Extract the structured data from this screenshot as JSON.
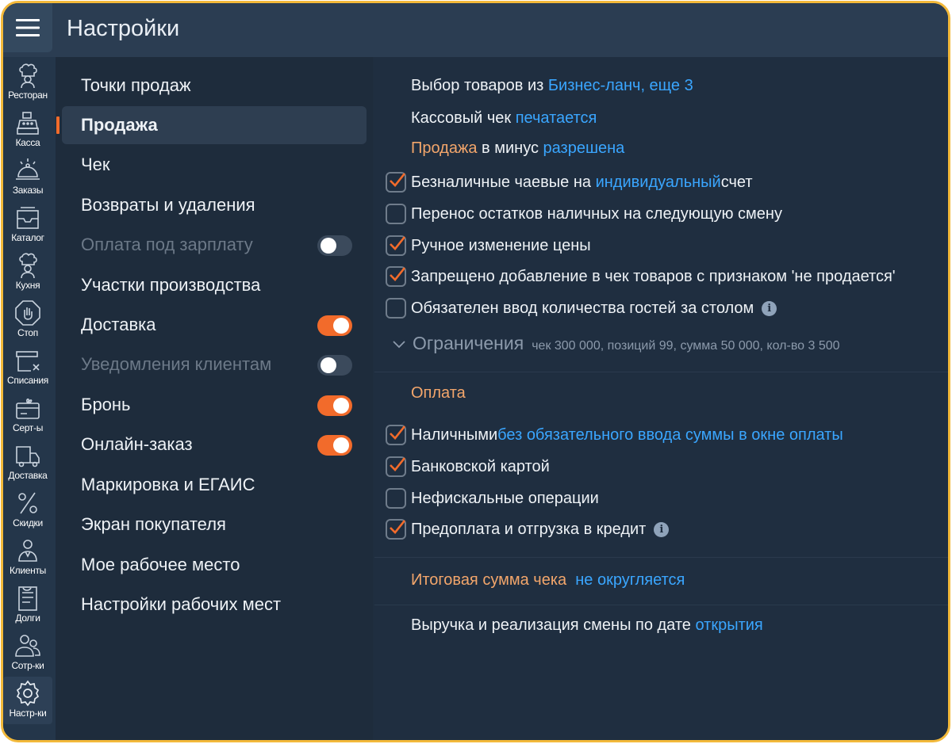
{
  "header": {
    "title": "Настройки"
  },
  "iconbar": [
    {
      "label": "Ресторан",
      "icon": "chef-icon"
    },
    {
      "label": "Касса",
      "icon": "cash-register-icon"
    },
    {
      "label": "Заказы",
      "icon": "cloche-icon"
    },
    {
      "label": "Каталог",
      "icon": "catalog-box-icon"
    },
    {
      "label": "Кухня",
      "icon": "cook-icon"
    },
    {
      "label": "Стоп",
      "icon": "stop-hand-icon"
    },
    {
      "label": "Списания",
      "icon": "writeoff-icon"
    },
    {
      "label": "Серт-ы",
      "icon": "gift-card-icon"
    },
    {
      "label": "Доставка",
      "icon": "delivery-truck-icon"
    },
    {
      "label": "Скидки",
      "icon": "percent-icon"
    },
    {
      "label": "Клиенты",
      "icon": "client-icon"
    },
    {
      "label": "Долги",
      "icon": "debt-list-icon"
    },
    {
      "label": "Сотр-ки",
      "icon": "staff-icon"
    },
    {
      "label": "Настр-ки",
      "icon": "gear-icon"
    }
  ],
  "menu": [
    {
      "label": "Точки продаж"
    },
    {
      "label": "Продажа",
      "active": true
    },
    {
      "label": "Чек"
    },
    {
      "label": "Возвраты и удаления"
    },
    {
      "label": "Оплата под зарплату",
      "disabled": true,
      "toggle": false
    },
    {
      "label": "Участки производства"
    },
    {
      "label": "Доставка",
      "toggle": true
    },
    {
      "label": "Уведомления клиентам",
      "disabled": true,
      "toggle": false
    },
    {
      "label": "Бронь",
      "toggle": true
    },
    {
      "label": "Онлайн-заказ",
      "toggle": true
    },
    {
      "label": "Маркировка и ЕГАИС"
    },
    {
      "label": "Экран покупателя"
    },
    {
      "label": "Мое рабочее место"
    },
    {
      "label": "Настройки рабочих мест"
    }
  ],
  "content": {
    "goods_choice": {
      "text": "Выбор товаров из ",
      "link": "Бизнес-ланч, еще 3"
    },
    "receipt": {
      "text": "Кассовый чек ",
      "link": "печатается"
    },
    "negative_sale": {
      "highlight": "Продажа",
      "text": " в минус ",
      "link": "разрешена"
    },
    "options": [
      {
        "checked": true,
        "pre": "Безналичные чаевые на ",
        "link": "индивидуальный",
        "post": " счет"
      },
      {
        "checked": false,
        "pre": "Перенос остатков наличных на следующую смену"
      },
      {
        "checked": true,
        "pre": "Ручное изменение цены"
      },
      {
        "checked": true,
        "pre": "Запрещено добавление в чек товаров с признаком 'не продается'"
      },
      {
        "checked": false,
        "pre": "Обязателен ввод количества гостей за столом",
        "info": true
      }
    ],
    "limits": {
      "title": "Ограничения",
      "summary": "чек 300 000, позиций 99, сумма 50 000, кол-во 3 500"
    },
    "payment": {
      "title": "Оплата",
      "options": [
        {
          "checked": true,
          "pre": "Наличными ",
          "link": "без обязательного ввода суммы в окне оплаты"
        },
        {
          "checked": true,
          "pre": "Банковской картой"
        },
        {
          "checked": false,
          "pre": "Нефискальные операции"
        },
        {
          "checked": true,
          "pre": "Предоплата и отгрузка в кредит",
          "info": true
        }
      ]
    },
    "rounding": {
      "label": "Итоговая сумма чека",
      "link": "не округляется"
    },
    "revenue": {
      "text": "Выручка и реализация смены по дате ",
      "link": "открытия"
    }
  },
  "colors": {
    "accent": "#f26b2b",
    "link": "#3aa6ff",
    "frame": "#f3b93a"
  }
}
